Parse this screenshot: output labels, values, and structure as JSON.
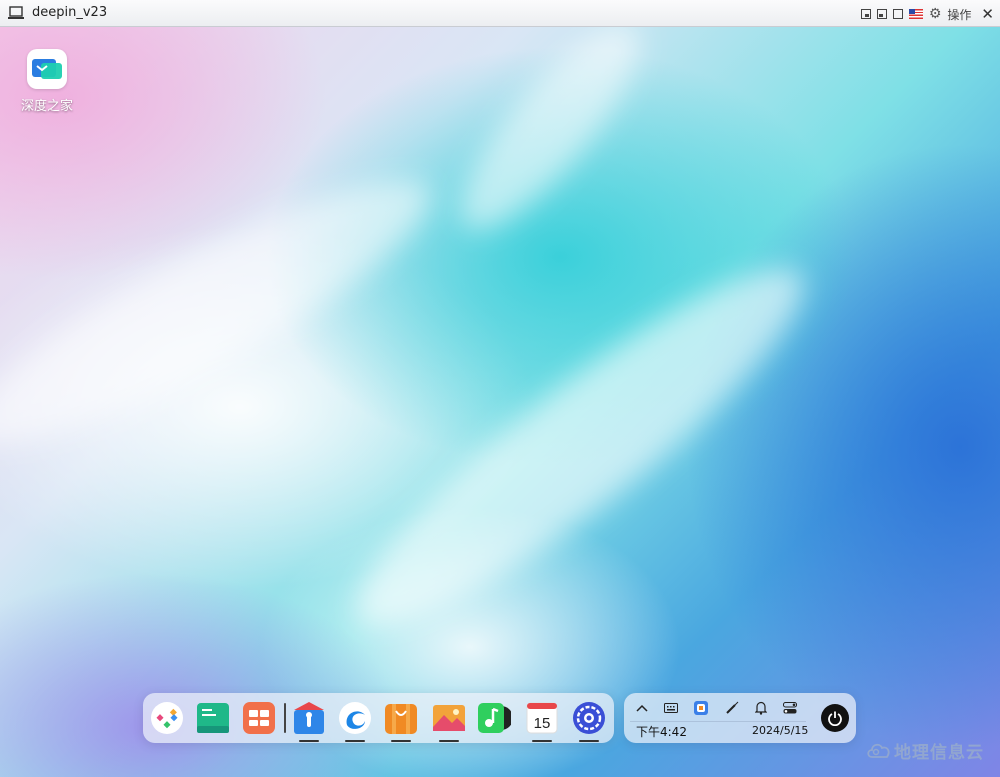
{
  "window": {
    "title": "deepin_v23",
    "operate_label": "操作"
  },
  "desktop": {
    "icons": [
      {
        "label": "深度之家",
        "icon": "deepin-home-icon"
      }
    ]
  },
  "dock": {
    "apps": [
      {
        "name": "launcher",
        "icon": "launcher-icon"
      },
      {
        "name": "multitasking",
        "icon": "multitasking-icon"
      },
      {
        "name": "app-store",
        "icon": "app-store-icon"
      },
      {
        "name": "file-manager",
        "icon": "file-manager-icon",
        "running": true
      },
      {
        "name": "browser",
        "icon": "browser-icon",
        "running": true
      },
      {
        "name": "deepin-store",
        "icon": "deepin-store-icon",
        "running": true
      },
      {
        "name": "image-viewer",
        "icon": "image-viewer-icon",
        "running": true
      },
      {
        "name": "music",
        "icon": "music-icon"
      },
      {
        "name": "calendar",
        "icon": "calendar-icon",
        "running": true,
        "day": "15"
      },
      {
        "name": "control-center",
        "icon": "control-center-icon",
        "running": true
      }
    ]
  },
  "tray": {
    "icons": [
      "chevron-up-icon",
      "keyboard-icon",
      "color-app-icon",
      "pen-icon",
      "bell-icon",
      "toggle-icon"
    ],
    "time": "下午4:42",
    "date": "2024/5/15"
  },
  "watermark": {
    "text": "地理信息云"
  }
}
